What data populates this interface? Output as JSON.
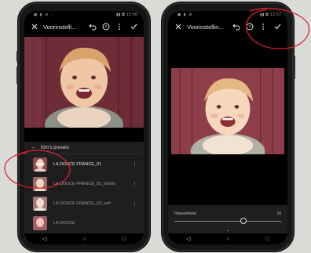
{
  "left_phone": {
    "status": {
      "left": "◼ ▮ ⊕ ·",
      "right": "▮▮ ◘ 13:56"
    },
    "title": "Voorinstelli...",
    "preset_header": "Kim's presets",
    "presets": [
      {
        "label": "LA DOUCE FRANCE_01",
        "active": true
      },
      {
        "label": "LA DOUCE FRANCE_02_holder",
        "active": false
      },
      {
        "label": "LA DOUCE FRANCE_03_soft",
        "active": false
      },
      {
        "label": "LA DOUCE",
        "active": false
      }
    ]
  },
  "right_phone": {
    "status": {
      "left": "◼ ▮ ⊕ ·",
      "right": "▮▮ ◘ 13:57"
    },
    "title": "Voorinstellin...",
    "amount_label": "Hoeveelheid",
    "amount_value": "10",
    "amount_fraction": 0.65
  },
  "icons": {
    "close": "close-icon",
    "undo": "undo-icon",
    "help": "help-icon",
    "more": "more-vertical-icon",
    "confirm": "checkmark-icon",
    "back": "arrow-left-icon"
  },
  "annotation_color": "#e02030"
}
